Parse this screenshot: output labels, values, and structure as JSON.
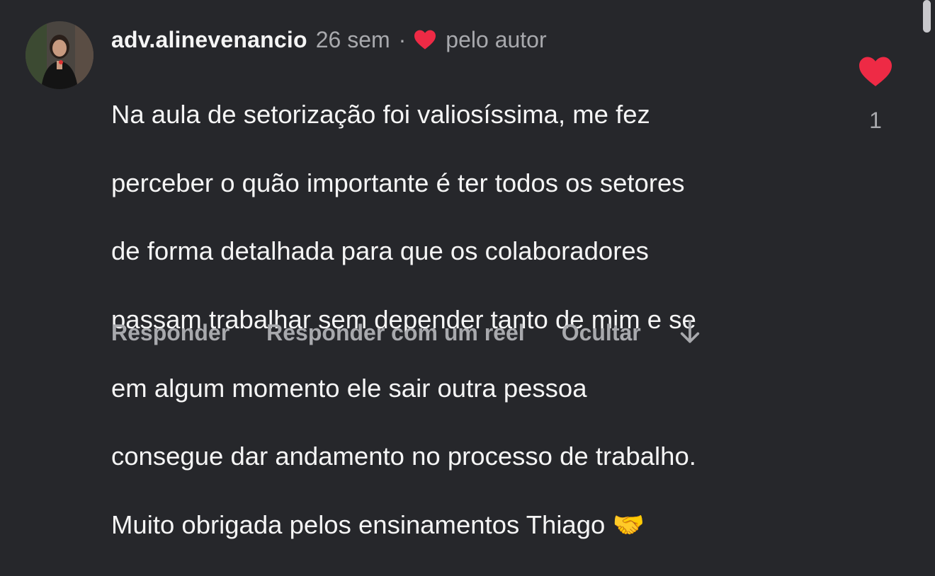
{
  "comment": {
    "username": "adv.alinevenancio",
    "time": "26 sem",
    "separator": "·",
    "liked_by_author_label": "pelo autor",
    "text_lines": [
      "Na aula de setorização  foi valiosíssima, me fez",
      "perceber o quão importante é ter todos os setores",
      "de forma detalhada para que os colaboradores",
      "passam trabalhar sem depender tanto de mim e se",
      "em algum momento ele sair outra pessoa",
      "consegue dar andamento no processo de trabalho.",
      "Muito obrigada pelos ensinamentos Thiago 🤝"
    ],
    "like_count": "1"
  },
  "actions": {
    "reply_label": "Responder",
    "reply_reel_label": "Responder com um reel",
    "hide_label": "Ocultar",
    "translate_icon": "down-arrow-icon"
  },
  "colors": {
    "background": "#26272b",
    "heart": "#ee2a45",
    "muted_text": "#a8a9ad",
    "primary_text": "#f5f5f5"
  }
}
